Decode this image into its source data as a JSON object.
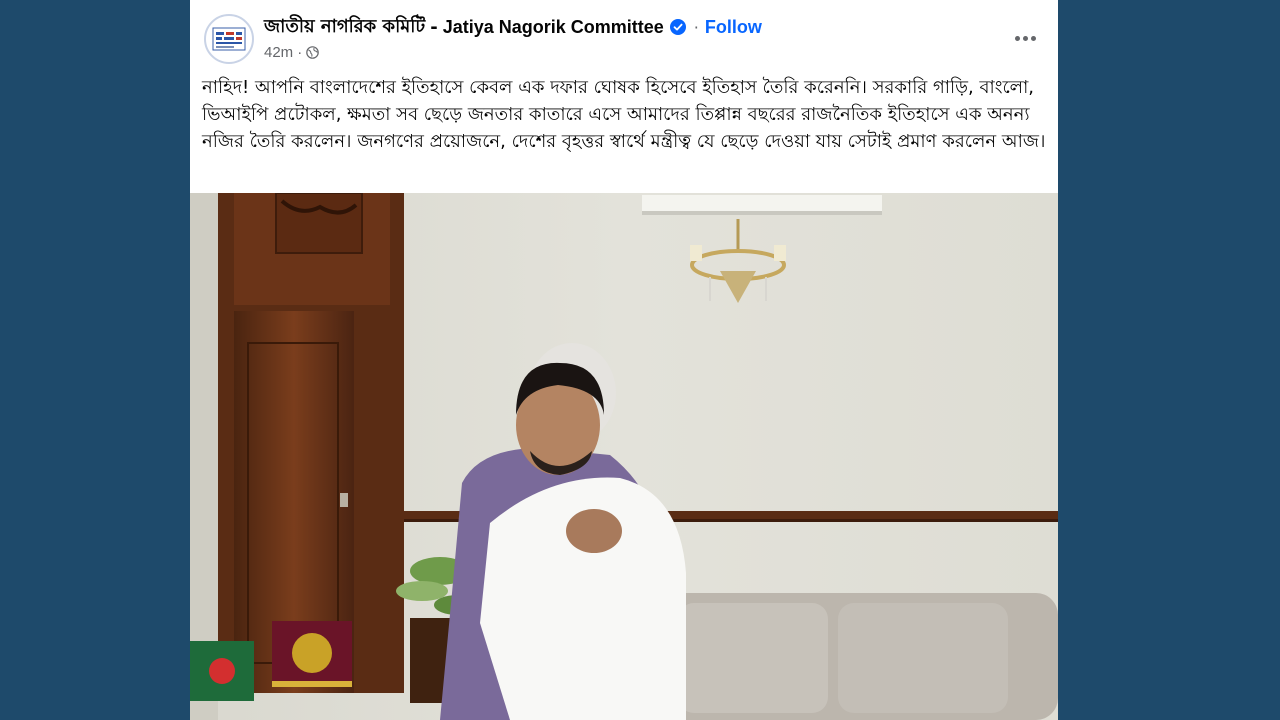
{
  "page": {
    "name_bn": "জাতীয় নাগরিক কমিটি",
    "separator": "-",
    "name_en": "Jatiya Nagorik Committee",
    "follow_label": "Follow",
    "time": "42m",
    "verified": true
  },
  "post": {
    "text": "নাহিদ! আপনি বাংলাদেশের ইতিহাসে কেবল এক দফার ঘোষক হিসেবে ইতিহাস তৈরি করেননি। সরকারি গাড়ি, বাংলো, ভিআইপি প্রটোকল, ক্ষমতা সব ছেড়ে জনতার কাতারে এসে আমাদের তিপ্পান্ন বছরের রাজনৈতিক ইতিহাসে এক অনন্য নজির তৈরি করলেন। জনগণের প্রয়োজনে, দেশের বৃহত্তর স্বার্থে মন্ত্রীত্ব যে ছেড়ে দেওয়া যায় সেটাই প্রমাণ করলেন আজ।"
  },
  "icons": {
    "verified": "verified-badge-icon",
    "audience": "globe-icon",
    "more": "more-options-icon"
  },
  "colors": {
    "background": "#1e4a6b",
    "accent": "#0866ff",
    "secondary_text": "#65676b"
  }
}
